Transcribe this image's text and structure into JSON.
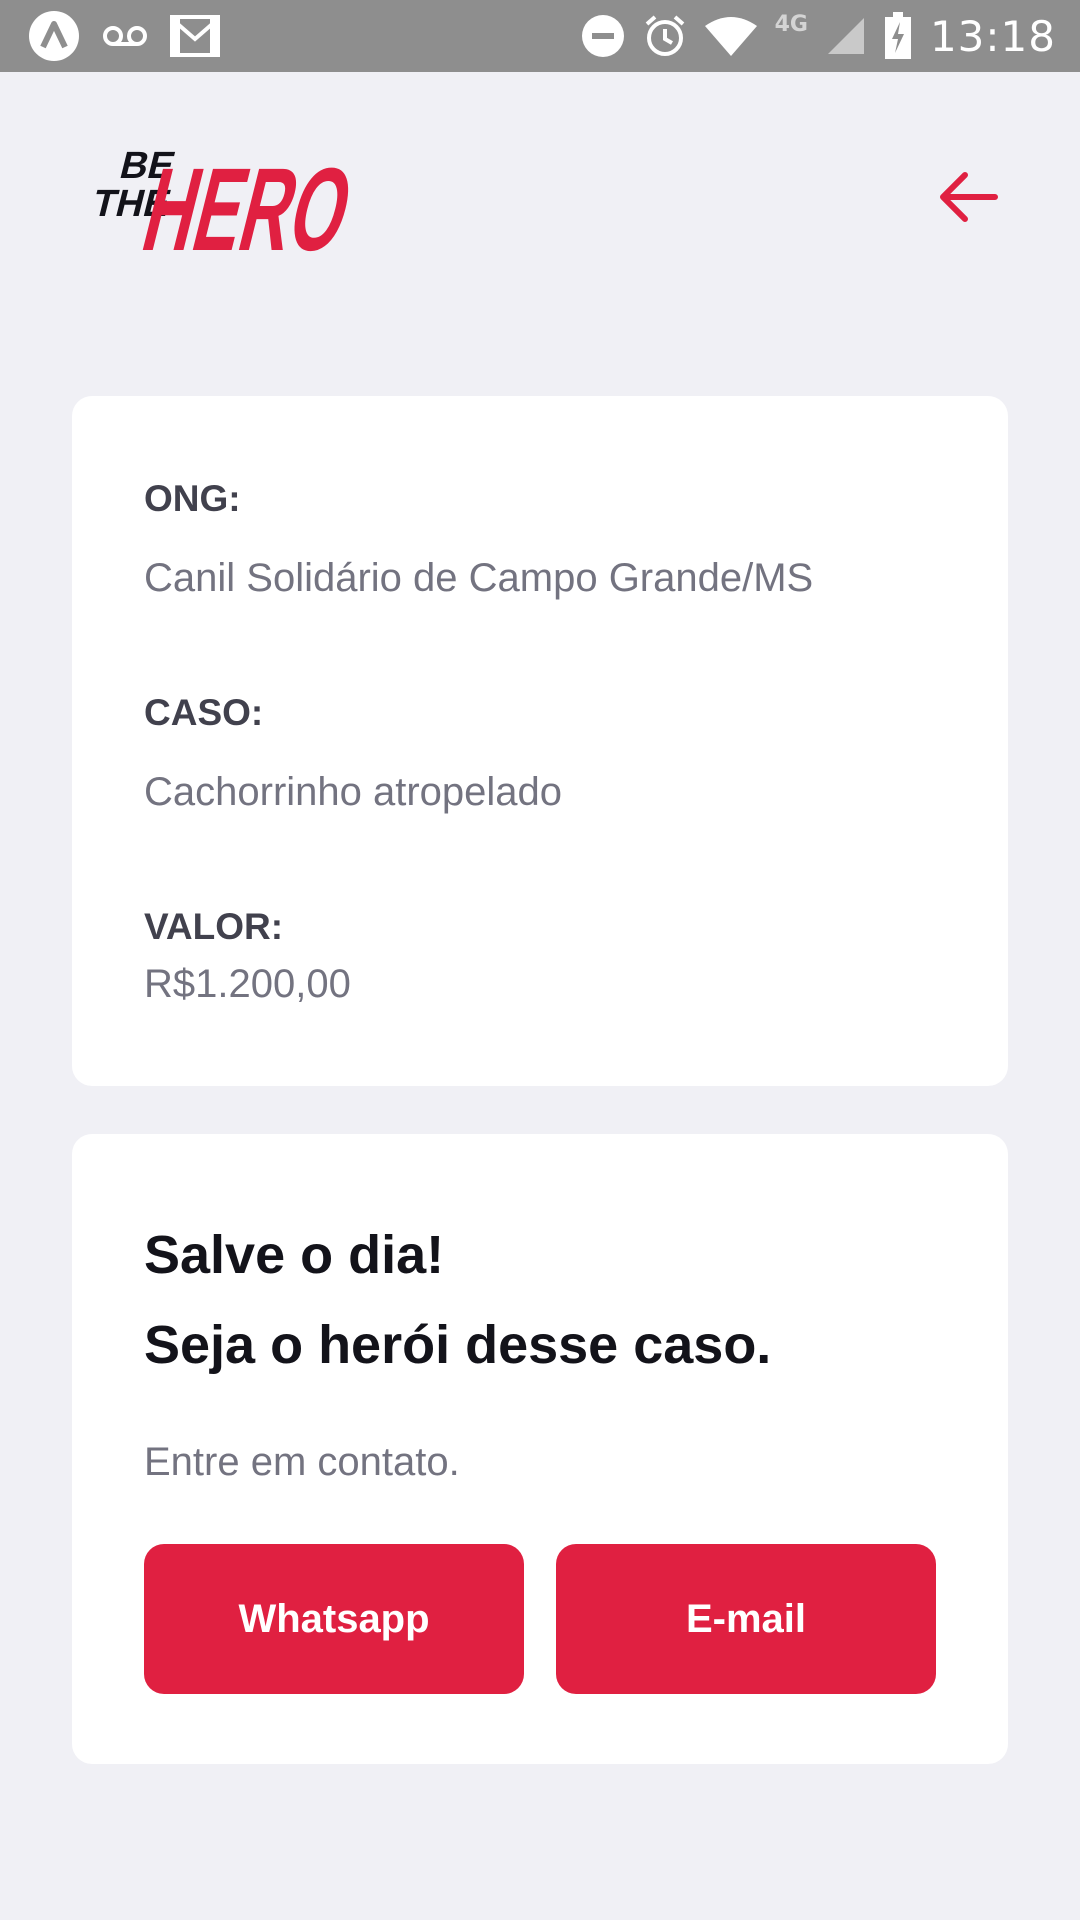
{
  "status_bar": {
    "time": "13:18",
    "network": "4G",
    "icons_left": [
      "app-icon",
      "voicemail-icon",
      "gmail-icon"
    ],
    "icons_right": [
      "dnd-icon",
      "alarm-icon",
      "wifi-icon",
      "signal-icon",
      "battery-charging-icon"
    ]
  },
  "header": {
    "logo_line1": "BE",
    "logo_line2": "THE",
    "logo_word": "HERO",
    "back_icon": "arrow-left-icon"
  },
  "incident": {
    "ong_label": "ONG:",
    "ong_value": "Canil Solidário de Campo Grande/MS",
    "case_label": "CASO:",
    "case_value": "Cachorrinho atropelado",
    "value_label": "VALOR:",
    "value_value": "R$1.200,00"
  },
  "contact": {
    "title_line1": "Salve o dia!",
    "title_line2": "Seja o herói desse caso.",
    "description": "Entre em contato.",
    "whatsapp_label": "Whatsapp",
    "email_label": "E-mail"
  },
  "colors": {
    "accent": "#e02041",
    "background": "#f0f0f5",
    "card": "#ffffff",
    "status_bar": "#8e8e8e"
  }
}
